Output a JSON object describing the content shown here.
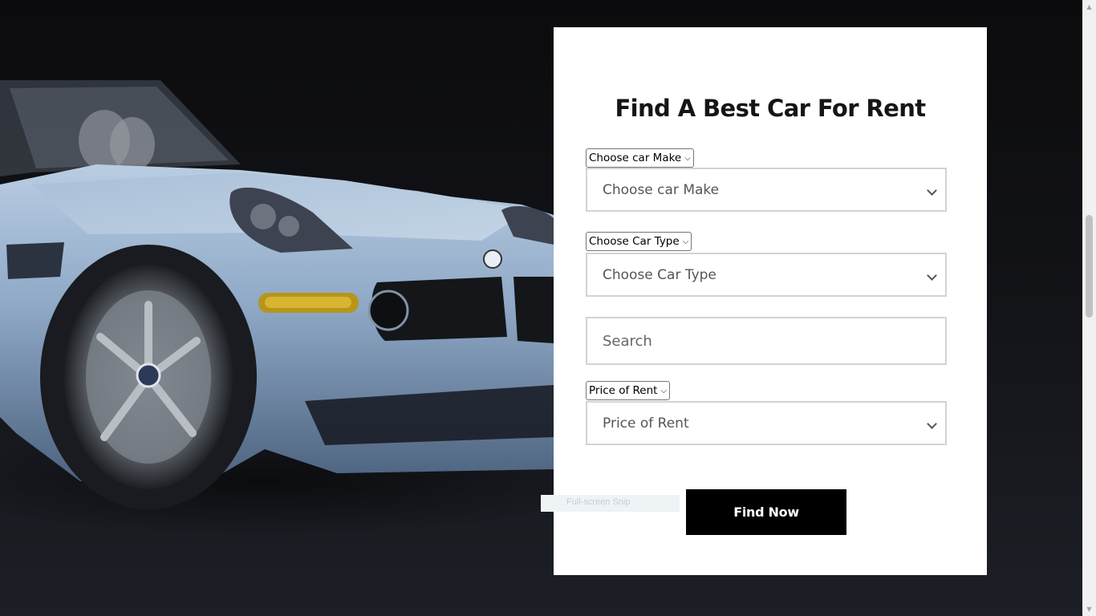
{
  "card": {
    "title": "Find A Best Car For Rent",
    "make": {
      "native_label": "Choose car Make",
      "styled_label": "Choose car Make"
    },
    "type": {
      "native_label": "Choose Car Type",
      "styled_label": "Choose Car Type"
    },
    "search": {
      "placeholder": "Search",
      "value": ""
    },
    "price": {
      "native_label": "Price of Rent",
      "styled_label": "Price of Rent"
    },
    "find_button": "Find Now"
  },
  "tooltip": "Full-screen Snip",
  "icons": {
    "native_caret": "chevron-down-icon",
    "styled_chevron": "chevron-down-icon",
    "scroll_up": "triangle-up-icon",
    "scroll_down": "triangle-down-icon"
  },
  "colors": {
    "background": "#0b0b0d",
    "card": "#ffffff",
    "button": "#000000",
    "car_body": "#8fa8c4"
  }
}
